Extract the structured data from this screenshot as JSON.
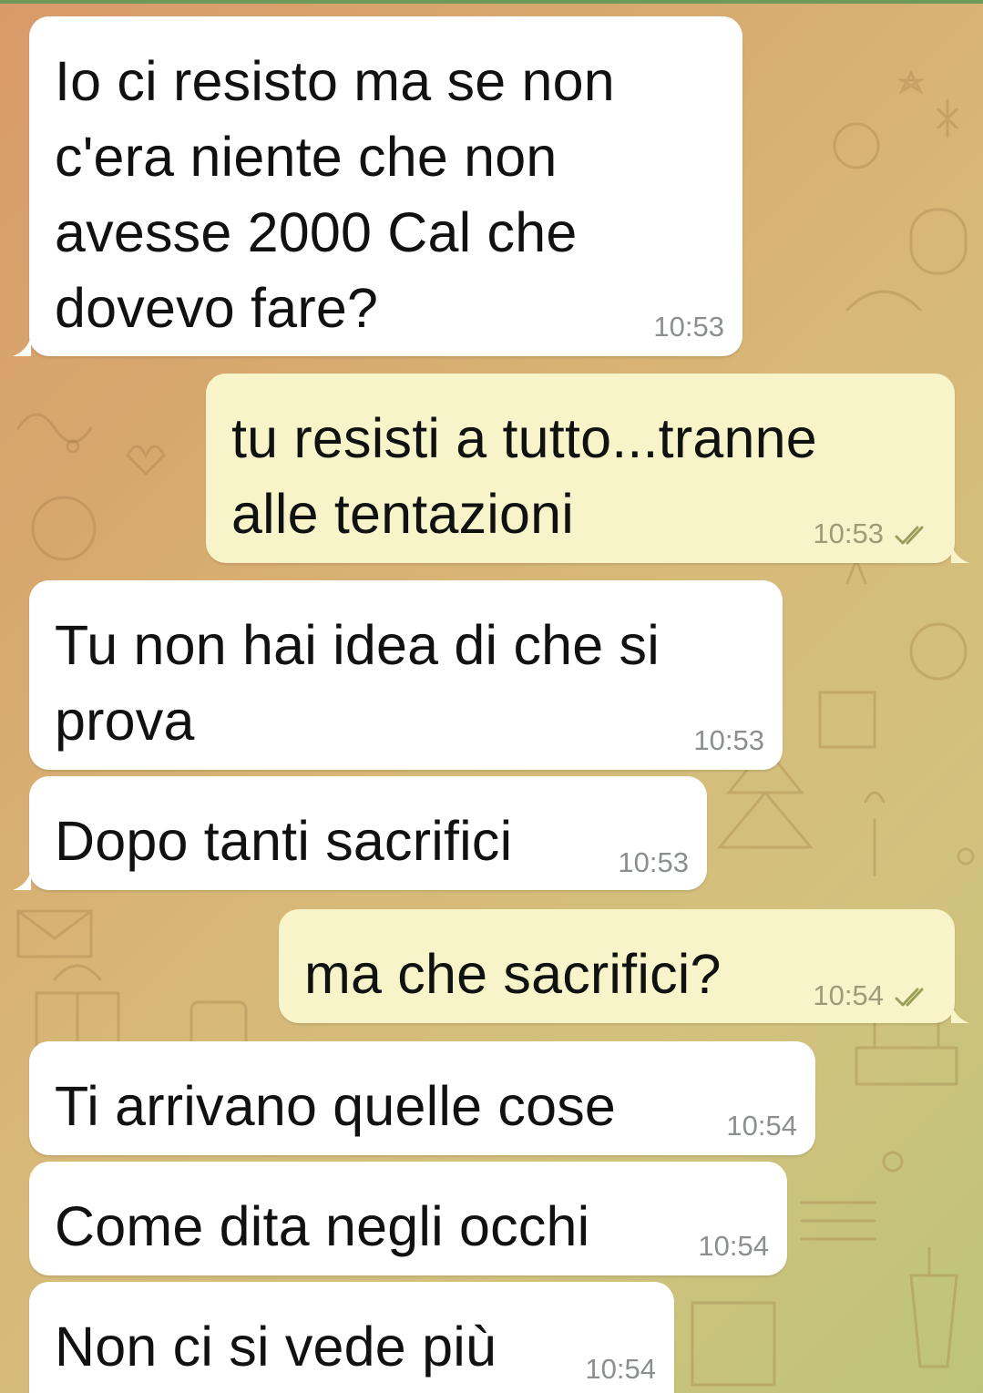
{
  "chat": {
    "messages": [
      {
        "direction": "incoming",
        "text": "Io ci resisto ma se non\nc'era niente che non\navesse 2000 Cal che\ndovevo fare?",
        "time": "10:53"
      },
      {
        "direction": "outgoing",
        "text": "tu resisti a tutto...tranne\nalle tentazioni",
        "time": "10:53",
        "status": "read"
      },
      {
        "direction": "incoming",
        "text": "Tu non hai idea di che si\nprova",
        "time": "10:53"
      },
      {
        "direction": "incoming",
        "text": "Dopo tanti sacrifici",
        "time": "10:53"
      },
      {
        "direction": "outgoing",
        "text": "ma che sacrifici?",
        "time": "10:54",
        "status": "read"
      },
      {
        "direction": "incoming",
        "text": "Ti arrivano quelle cose",
        "time": "10:54"
      },
      {
        "direction": "incoming",
        "text": "Come dita negli occhi",
        "time": "10:54"
      },
      {
        "direction": "incoming",
        "text": "Non ci si vede più",
        "time": "10:54"
      }
    ]
  },
  "colors": {
    "incoming_bubble": "#ffffff",
    "outgoing_bubble": "#f8f4c9",
    "read_ticks": "#9aa05c",
    "wallpaper": "#d8b878"
  },
  "icons": {
    "read_status": "double-check-icon"
  }
}
